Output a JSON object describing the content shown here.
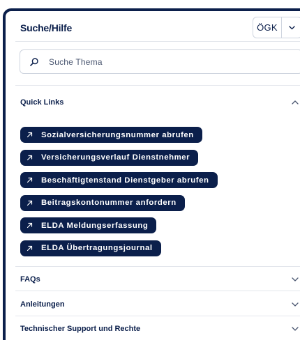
{
  "panel": {
    "title": "Suche/Hilfe",
    "org_select": {
      "value": "ÖGK",
      "icon": "chevron-down-icon"
    }
  },
  "search": {
    "placeholder": "Suche Thema",
    "value": "",
    "icon": "search-icon"
  },
  "quick_links": {
    "title": "Quick Links",
    "expanded": true,
    "items": [
      {
        "label": "Sozialversicherungsnummer abrufen"
      },
      {
        "label": "Versicherungsverlauf Dienstnehmer"
      },
      {
        "label": "Beschäftigtenstand Dienstgeber abrufen"
      },
      {
        "label": "Beitragskontonummer anfordern"
      },
      {
        "label": "ELDA Meldungserfassung"
      },
      {
        "label": "ELDA Übertragungsjournal"
      }
    ]
  },
  "sections": [
    {
      "label": "FAQs",
      "expanded": false
    },
    {
      "label": "Anleitungen",
      "expanded": false
    },
    {
      "label": "Technischer Support und Rechte",
      "expanded": false
    }
  ],
  "colors": {
    "primary": "#0b1f4b",
    "border": "#cfd5df",
    "divider": "#e3e6ec",
    "background": "#ffffff"
  }
}
